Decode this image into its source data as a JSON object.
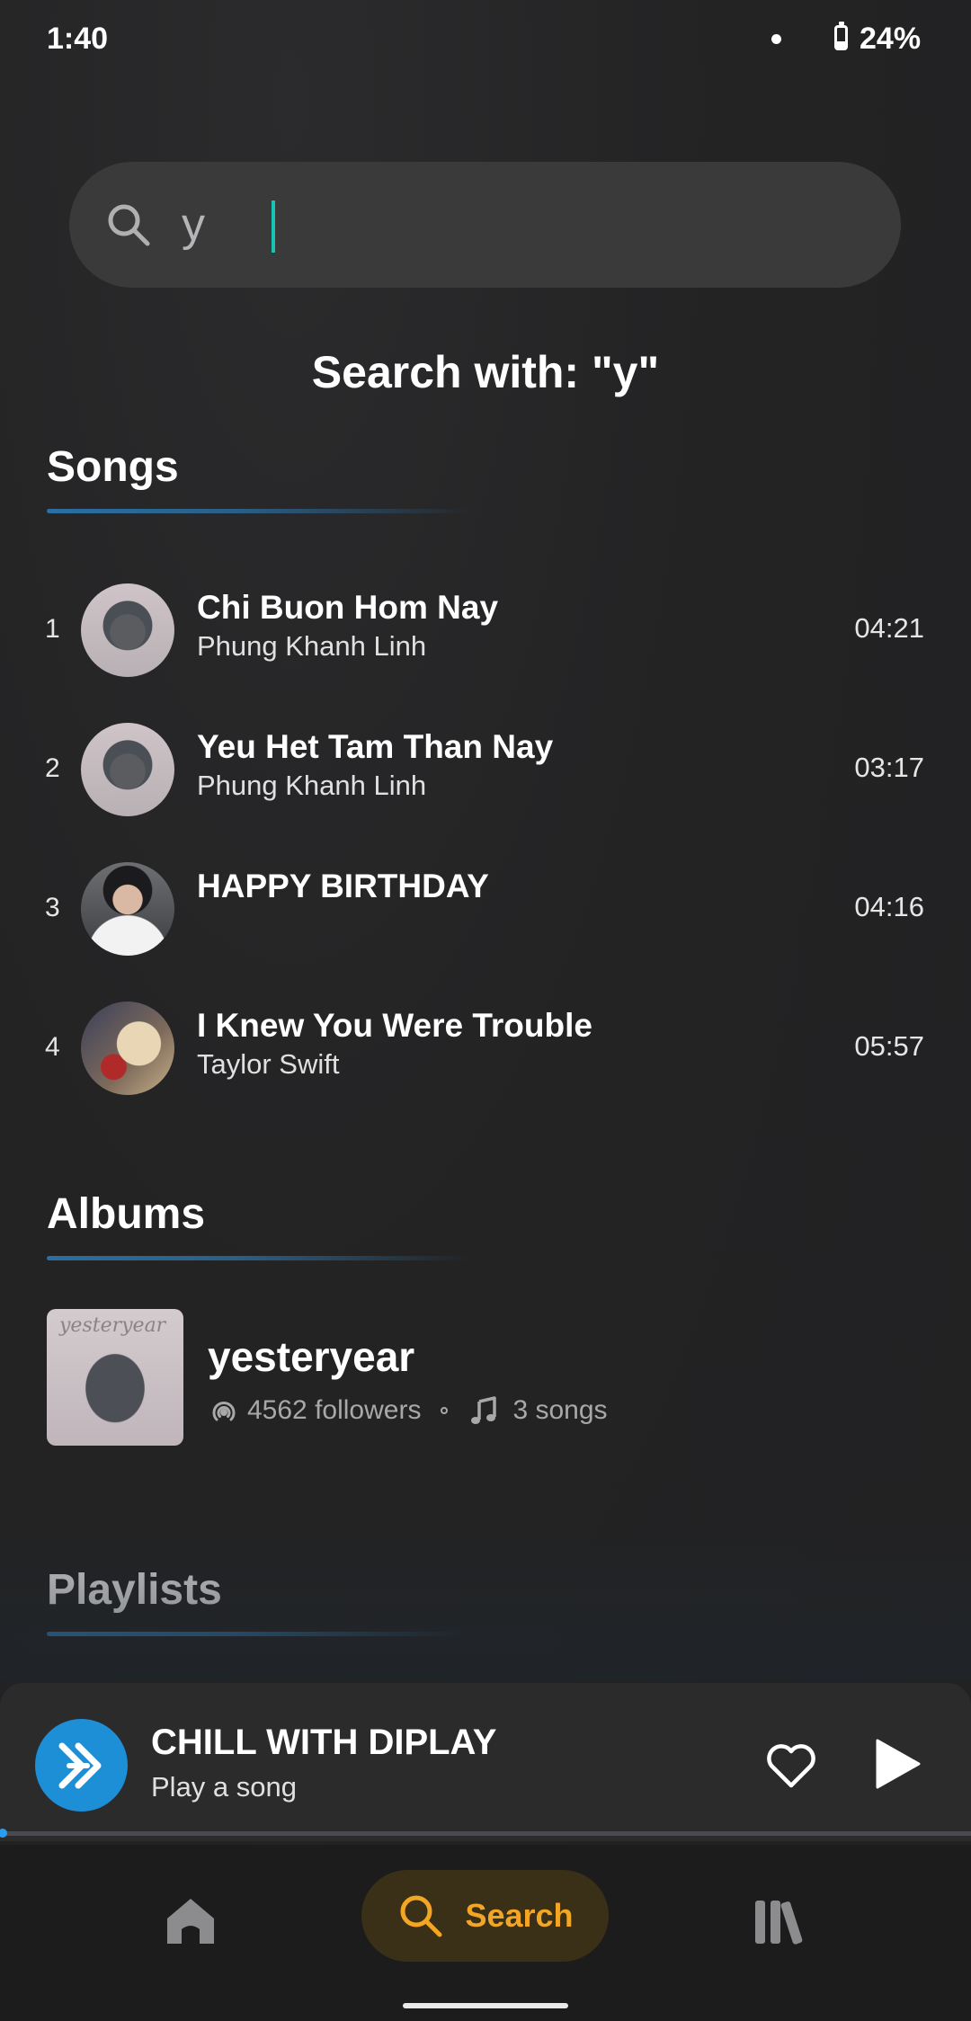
{
  "status_bar": {
    "time": "1:40",
    "battery": "24%"
  },
  "search": {
    "query": "y",
    "heading": "Search with: \"y\""
  },
  "sections": {
    "songs": "Songs",
    "albums": "Albums",
    "playlists": "Playlists"
  },
  "songs": [
    {
      "index": "1",
      "title": "Chi Buon Hom Nay",
      "artist": "Phung Khanh Linh",
      "duration": "04:21"
    },
    {
      "index": "2",
      "title": "Yeu Het Tam Than Nay",
      "artist": "Phung Khanh Linh",
      "duration": "03:17"
    },
    {
      "index": "3",
      "title": "HAPPY BIRTHDAY",
      "artist": "",
      "duration": "04:16"
    },
    {
      "index": "4",
      "title": "I Knew You Were Trouble",
      "artist": "Taylor Swift",
      "duration": "05:57"
    }
  ],
  "album": {
    "title": "yesteryear",
    "followers": "4562 followers",
    "songs": "3 songs",
    "cover_text": "yesteryear"
  },
  "player": {
    "title": "CHILL WITH DIPLAY",
    "subtitle": "Play a song",
    "progress": 0.0
  },
  "nav": {
    "search_label": "Search"
  },
  "colors": {
    "accent_nav": "#f3a623",
    "accent_blue": "#1d8fd6",
    "caret": "#18c3b5"
  }
}
